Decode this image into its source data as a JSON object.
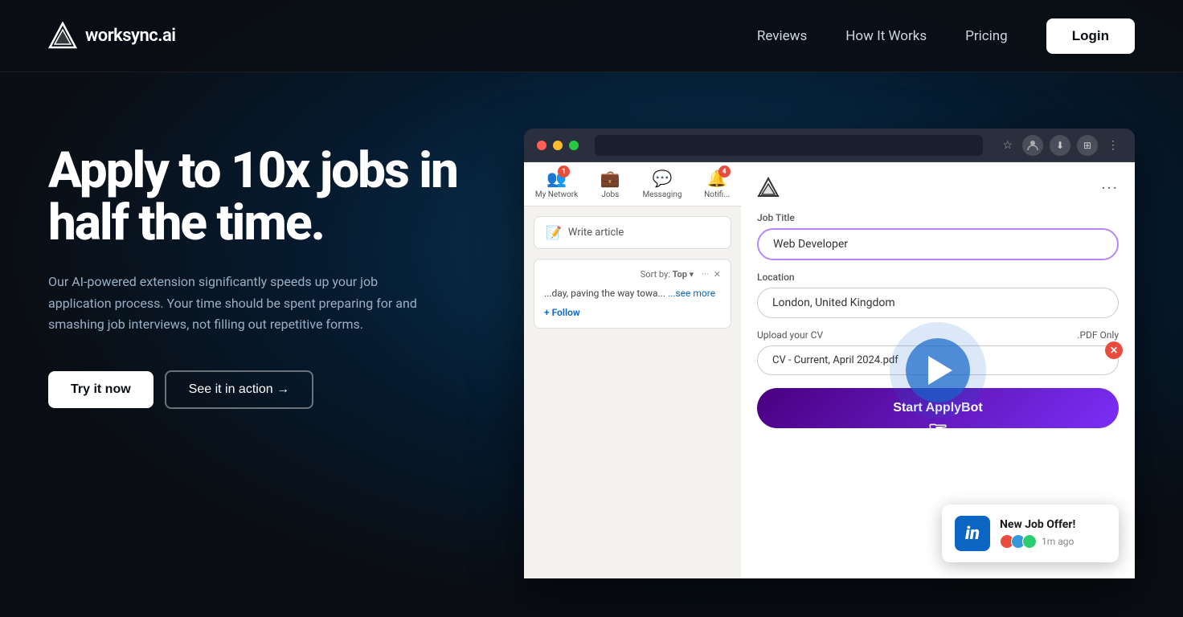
{
  "brand": {
    "name": "worksync.ai",
    "logo_alt": "WorkSync Logo"
  },
  "nav": {
    "reviews": "Reviews",
    "how_it_works": "How It Works",
    "pricing": "Pricing",
    "login": "Login"
  },
  "hero": {
    "heading_line1": "Apply to 10x jobs in",
    "heading_line2": "half the time.",
    "description": "Our AI-powered extension significantly speeds up your job application process. Your time should be spent preparing for and smashing job interviews, not filling out repetitive forms.",
    "cta_primary": "Try it now",
    "cta_secondary": "See it in action →"
  },
  "mockup": {
    "linkedin": {
      "nav_items": [
        {
          "label": "My Network",
          "icon": "👥",
          "badge": "1"
        },
        {
          "label": "Jobs",
          "icon": "💼",
          "badge": ""
        },
        {
          "label": "Messaging",
          "icon": "💬",
          "badge": ""
        },
        {
          "label": "Notifications",
          "icon": "🔔",
          "badge": "4"
        }
      ],
      "write_article": "Write article",
      "sort_label": "Sort by: Top",
      "post_text": "...day, paving the way towa...",
      "see_more": "...see more",
      "follow_label": "+ Follow"
    },
    "extension": {
      "menu_dots": "···",
      "job_title_label": "Job Title",
      "job_title_value": "Web Developer",
      "location_label": "Location",
      "location_value": "London, United Kingdom",
      "upload_label": "Upload your CV",
      "upload_pdf_note": ".PDF Only",
      "cv_filename": "CV - Current, April 2024.pdf",
      "start_button": "Start ApplyBot"
    },
    "notification": {
      "title": "New Job Offer!",
      "time": "1m ago",
      "platform": "in"
    }
  }
}
